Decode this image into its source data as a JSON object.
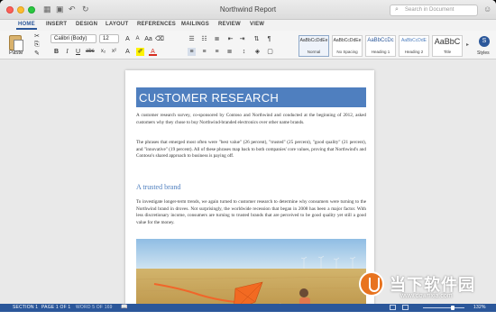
{
  "window": {
    "title": "Northwind Report"
  },
  "search": {
    "placeholder": "Search in Document"
  },
  "tabs": [
    "HOME",
    "INSERT",
    "DESIGN",
    "LAYOUT",
    "REFERENCES",
    "MAILINGS",
    "REVIEW",
    "VIEW"
  ],
  "ribbon": {
    "paste_label": "Paste",
    "font_name": "Calibri (Body)",
    "font_size": "12",
    "styles": [
      {
        "preview": "AaBbCcDdEe",
        "name": "Normal"
      },
      {
        "preview": "AaBbCcDdEe",
        "name": "No Spacing"
      },
      {
        "preview": "AaBbCcDc",
        "name": "Heading 1"
      },
      {
        "preview": "AaBbCcDdE",
        "name": "Heading 2"
      },
      {
        "preview": "AaBbC",
        "name": "Title"
      }
    ],
    "styles_pane_label": "Styles"
  },
  "document": {
    "heading": "CUSTOMER RESEARCH",
    "para1": "A customer research survey, co-sponsored by Contoso and Northwind and conducted at the beginning of 2012, asked customers why they chose to buy Northwind-branded electronics over other name brands.",
    "para2": "The phrases that emerged most often were \"best value\" (26 percent), \"trusted\" (25 percent), \"good quality\" (21 percent), and \"innovative\" (19 percent). All of these phrases map back to both companies' core values, proving that Northwind's and Contoso's shared approach to business is paying off.",
    "subheading": "A trusted brand",
    "para3": "To investigate longer-term trends, we again turned to customer research to determine why consumers were turning to the Northwind brand in droves. Not surprisingly, the worldwide recession that began in 2008 has been a major factor. With less discretionary income, consumers are turning to trusted brands that are perceived to be good quality yet still a good value for the money."
  },
  "status": {
    "section": "SECTION 1",
    "page": "PAGE 1 OF 1",
    "words": "WORD 5 OF 169",
    "zoom": "132%"
  },
  "watermark": {
    "text": "当下软件园",
    "url": "www.downxia.com"
  },
  "colors": {
    "accent": "#2b579a",
    "heading_fill": "#4f7fbf"
  }
}
